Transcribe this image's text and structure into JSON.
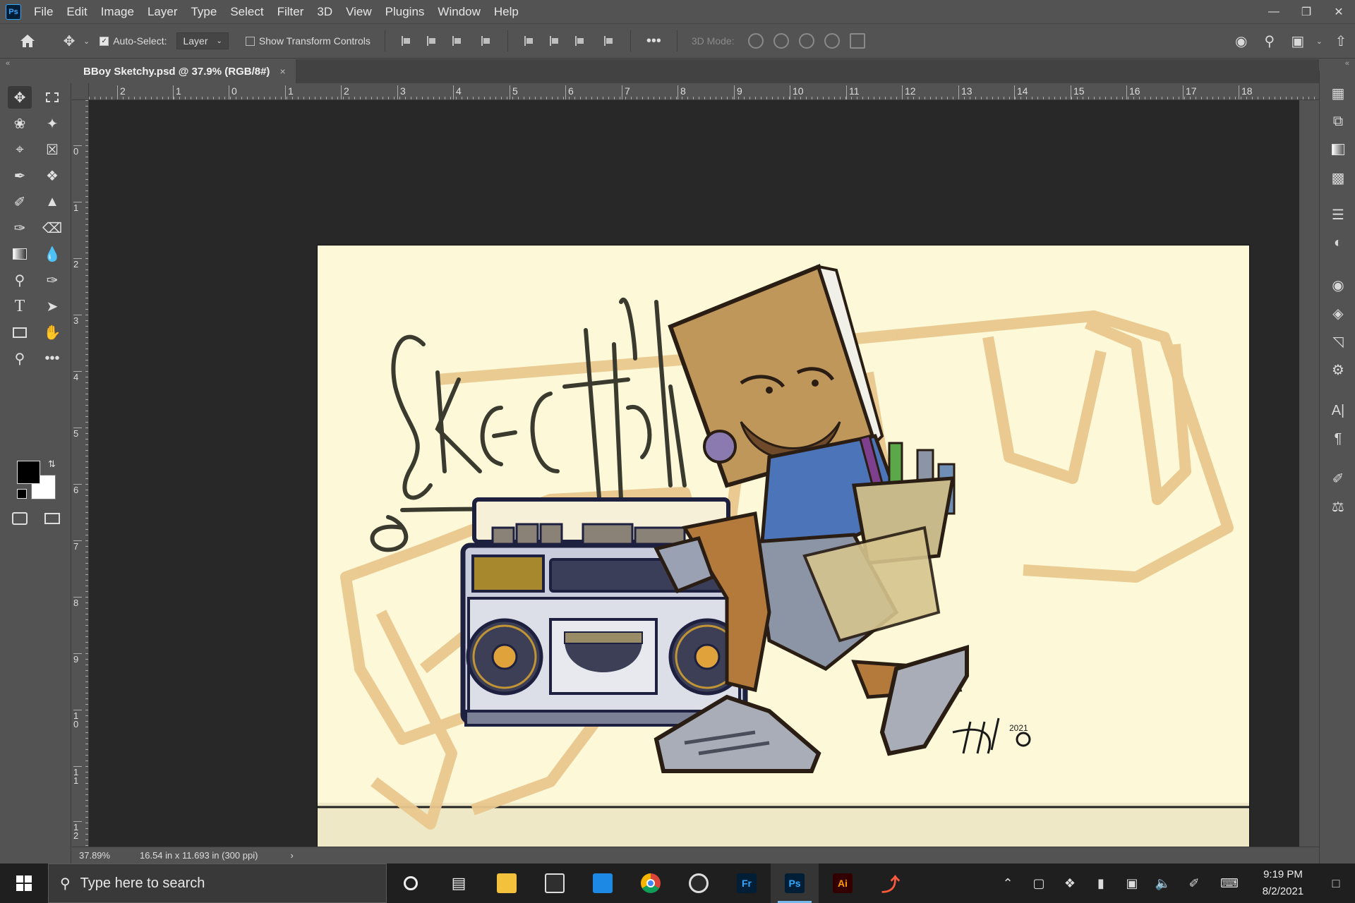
{
  "app": {
    "logo_text": "Ps"
  },
  "menu": [
    "File",
    "Edit",
    "Image",
    "Layer",
    "Type",
    "Select",
    "Filter",
    "3D",
    "View",
    "Plugins",
    "Window",
    "Help"
  ],
  "options": {
    "auto_select_label": "Auto-Select:",
    "auto_select_checked": true,
    "target_value": "Layer",
    "show_transform_label": "Show Transform Controls",
    "show_transform_checked": false,
    "mode3d_label": "3D Mode:"
  },
  "document": {
    "tab_title": "BBoy Sketchy.psd @ 37.9% (RGB/8#)",
    "close": "×"
  },
  "rulers": {
    "horizontal": [
      "2",
      "1",
      "0",
      "1",
      "2",
      "3",
      "4",
      "5",
      "6",
      "7",
      "8",
      "9",
      "10",
      "11",
      "12",
      "13",
      "14",
      "15",
      "16",
      "17",
      "18"
    ],
    "vertical": [
      "0",
      "1",
      "2",
      "3",
      "4",
      "5",
      "6",
      "7",
      "8",
      "9",
      "10",
      "11",
      "12"
    ]
  },
  "artwork": {
    "logo_text": "SKEtchy",
    "signature": "JHH",
    "signature_year": "2021"
  },
  "status": {
    "zoom": "37.89%",
    "doc_size": "16.54 in x 11.693 in (300 ppi)",
    "arrow": "›"
  },
  "taskbar": {
    "search_placeholder": "Type here to search",
    "time": "9:19 PM",
    "date": "8/2/2021",
    "apps": [
      "Cortana",
      "Task View",
      "File Explorer",
      "Microsoft Store",
      "Mail",
      "Chrome",
      "OBS",
      "Fr",
      "Ps",
      "Ai",
      "Sketch app"
    ]
  },
  "colors": {
    "ui_bg": "#535353",
    "pasteboard": "#282828",
    "artboard_bg": "#fdf9d8",
    "ps_blue": "#31a8ff",
    "ai_orange": "#ff9a00",
    "fr_blue": "#2fa6ff"
  }
}
